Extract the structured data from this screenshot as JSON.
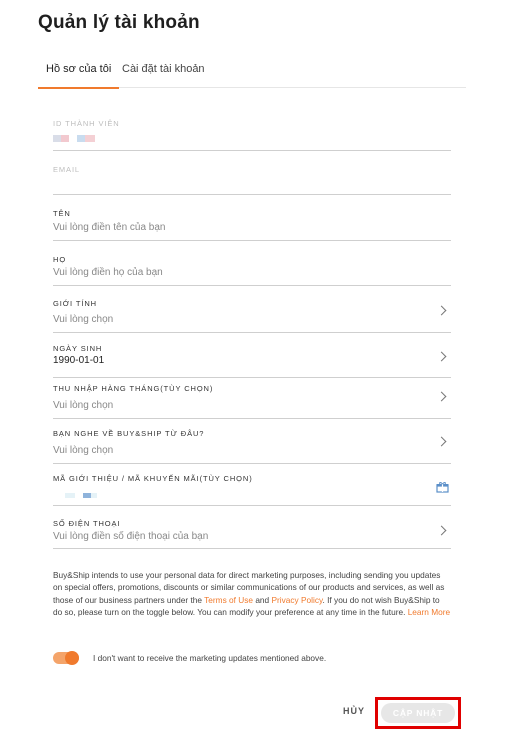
{
  "page": {
    "title": "Quản lý tài khoản"
  },
  "tabs": [
    {
      "label": "Hồ sơ của tôi",
      "active": true
    },
    {
      "label": "Cài đặt tài khoản",
      "active": false
    }
  ],
  "fields": {
    "member_id": {
      "label": "ID THÀNH VIÊN"
    },
    "email": {
      "label": "EMAIL"
    },
    "first_name": {
      "label": "TÊN",
      "placeholder": "Vui lòng điền tên của bạn"
    },
    "last_name": {
      "label": "HỌ",
      "placeholder": "Vui lòng điền họ của bạn"
    },
    "gender": {
      "label": "GIỚI TÍNH",
      "placeholder": "Vui lòng chọn"
    },
    "birthday": {
      "label": "NGÀY SINH",
      "value": "1990-01-01"
    },
    "income": {
      "label": "THU NHẬP HÀNG THÁNG(TÙY CHỌN)",
      "placeholder": "Vui lòng chọn"
    },
    "source": {
      "label": "BẠN NGHE VỀ BUY&SHIP TỪ ĐÂU?",
      "placeholder": "Vui lòng chọn"
    },
    "referral": {
      "label": "MÃ GIỚI THIỆU / MÃ KHUYẾN MÃI(TÙY CHỌN)"
    },
    "phone": {
      "label": "SỐ ĐIỆN THOẠI",
      "placeholder": "Vui lòng điền số điện thoại của bạn"
    }
  },
  "disclaimer": {
    "part1": "Buy&Ship intends to use your personal data for direct marketing purposes, including sending you updates on special offers, promotions, discounts or similar communications of our products and services, as well as those of our business partners under the ",
    "terms_link": "Terms of Use",
    "and": " and ",
    "privacy_link": "Privacy Policy",
    "part2": ". If you do not wish Buy&Ship to do so, please turn on the toggle below. You can modify your preference at any time in the future. ",
    "learn_more": "Learn More"
  },
  "marketing_toggle": {
    "label": "I don't want to receive the marketing updates mentioned above.",
    "on": true
  },
  "actions": {
    "cancel": "HỦY",
    "update": "CẬP NHẬT"
  },
  "colors": {
    "accent": "#f07a2d",
    "highlight": "#e00000"
  }
}
